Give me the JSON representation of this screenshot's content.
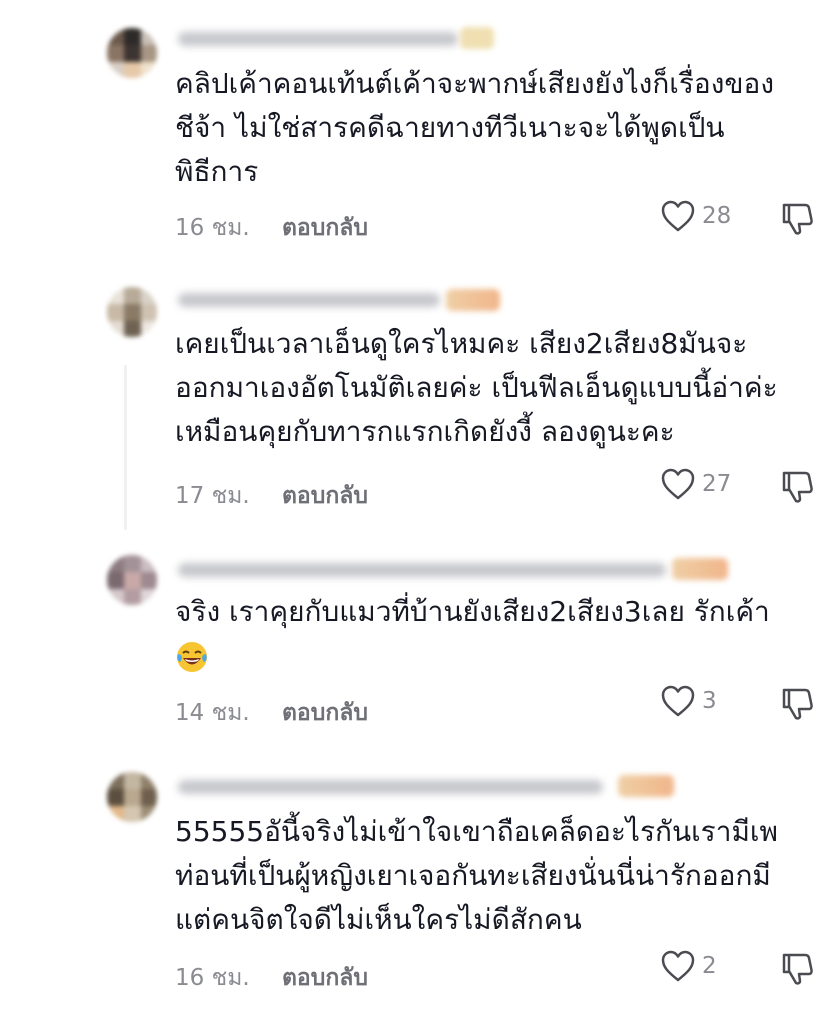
{
  "comments": [
    {
      "text_lines": [
        "คลิปเค้าคอนเท้นต์เค้าจะพากษ์เสียงยังไงก็เรื่องของ",
        "ชีจ้า ไม่ใช่สารคดีฉายทางทีวีเนาะจะได้พูดเป็น",
        "พิธีการ"
      ],
      "time": "16 ชม.",
      "reply": "ตอบกลับ",
      "likes": "28"
    },
    {
      "text_lines": [
        "เคยเป็นเวลาเอ็นดูใครไหมคะ เสียง2เสียง8มันจะ",
        "ออกมาเองอัตโนมัติเลยค่ะ เป็นฟีลเอ็นดูแบบนี้อ่าค่ะ",
        "เหมือนคุยกับทารกแรกเกิดยังงี้ ลองดูนะคะ"
      ],
      "time": "17 ชม.",
      "reply": "ตอบกลับ",
      "likes": "27"
    },
    {
      "text_lines": [
        "จริง เราคุยกับแมวที่บ้านยังเสียง2เสียง3เลย รักเค้า"
      ],
      "time": "14 ชม.",
      "reply": "ตอบกลับ",
      "likes": "3"
    },
    {
      "text_lines": [
        "55555อันี้จริงไม่เข้าใจเขาถือเคล็ดอะไรกันเรามีเพ",
        "ท่อนที่เป็นผู้หญิงเยาเจอกันทะเสียงนั่นนี่น่ารักออกมี",
        "แต่คนจิตใจดีไม่เห็นใครไม่ดีสักคน"
      ],
      "time": "16 ชม.",
      "reply": "ตอบกลับ",
      "likes": "2"
    }
  ],
  "icons": {
    "like": "heart-outline-icon",
    "dislike": "thumbs-down-outline-icon",
    "emoji": "laughing-tears-emoji"
  },
  "colors": {
    "text": "#161823",
    "meta": "#8a8b91",
    "reply": "#6f7077",
    "icon": "#4b4c52"
  }
}
